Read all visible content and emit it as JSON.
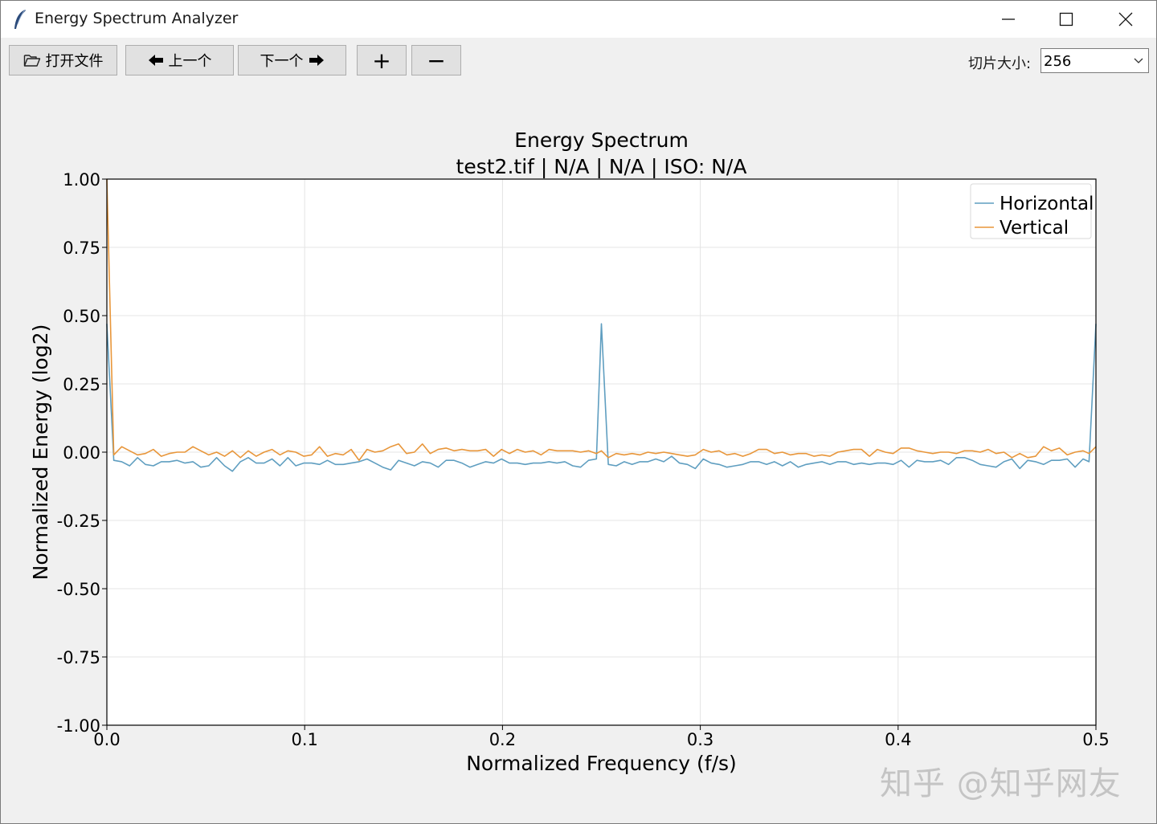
{
  "window": {
    "title": "Energy Spectrum Analyzer"
  },
  "toolbar": {
    "open_label": "打开文件",
    "prev_label": "上一个",
    "next_label": "下一个",
    "zoom_in_label": "+",
    "zoom_out_label": "−",
    "slice_size_label": "切片大小:",
    "slice_size_value": "256"
  },
  "icons": {
    "app": "feather-icon",
    "open": "folder-icon",
    "prev": "arrow-left-icon",
    "next": "arrow-right-icon",
    "minimize": "minimize-icon",
    "maximize": "maximize-icon",
    "close": "close-icon"
  },
  "watermark": "知乎 @知乎网友",
  "chart_data": {
    "type": "line",
    "title": "Energy Spectrum",
    "subtitle": "test2.tif | N/A | N/A | ISO: N/A",
    "xlabel": "Normalized Frequency (f/s)",
    "ylabel": "Normalized Energy (log2)",
    "xlim": [
      0,
      0.5
    ],
    "ylim": [
      -1,
      1
    ],
    "xticks": [
      0,
      0.1,
      0.2,
      0.3,
      0.4,
      0.5
    ],
    "xtick_labels": [
      "0.0",
      "0.1",
      "0.2",
      "0.3",
      "0.4",
      "0.5"
    ],
    "yticks": [
      1,
      0.75,
      0.5,
      0.25,
      0,
      -0.25,
      -0.5,
      -0.75,
      -1
    ],
    "ytick_labels": [
      "1.00",
      "0.75",
      "0.50",
      "0.25",
      "0.00",
      "-0.25",
      "-0.50",
      "-0.75",
      "-1.00"
    ],
    "grid": true,
    "legend": "top-right",
    "series": [
      {
        "name": "Horizontal",
        "color": "#5f9ec0",
        "points": [
          [
            0.0,
            0.47
          ],
          [
            0.0035,
            -0.03
          ],
          [
            0.0075,
            -0.035
          ],
          [
            0.0115,
            -0.05
          ],
          [
            0.0155,
            -0.02
          ],
          [
            0.0195,
            -0.045
          ],
          [
            0.0235,
            -0.05
          ],
          [
            0.0275,
            -0.035
          ],
          [
            0.0315,
            -0.035
          ],
          [
            0.0355,
            -0.03
          ],
          [
            0.0395,
            -0.04
          ],
          [
            0.0435,
            -0.035
          ],
          [
            0.0475,
            -0.055
          ],
          [
            0.0515,
            -0.05
          ],
          [
            0.0555,
            -0.02
          ],
          [
            0.0595,
            -0.05
          ],
          [
            0.0635,
            -0.07
          ],
          [
            0.0675,
            -0.035
          ],
          [
            0.0715,
            -0.02
          ],
          [
            0.0755,
            -0.04
          ],
          [
            0.0795,
            -0.04
          ],
          [
            0.0835,
            -0.025
          ],
          [
            0.0875,
            -0.05
          ],
          [
            0.0915,
            -0.02
          ],
          [
            0.0955,
            -0.05
          ],
          [
            0.0995,
            -0.04
          ],
          [
            0.1035,
            -0.04
          ],
          [
            0.1075,
            -0.045
          ],
          [
            0.1115,
            -0.03
          ],
          [
            0.1155,
            -0.045
          ],
          [
            0.1195,
            -0.045
          ],
          [
            0.1235,
            -0.04
          ],
          [
            0.1275,
            -0.035
          ],
          [
            0.1315,
            -0.025
          ],
          [
            0.1355,
            -0.04
          ],
          [
            0.1395,
            -0.055
          ],
          [
            0.1435,
            -0.065
          ],
          [
            0.1475,
            -0.03
          ],
          [
            0.1515,
            -0.04
          ],
          [
            0.1555,
            -0.05
          ],
          [
            0.1595,
            -0.035
          ],
          [
            0.1635,
            -0.04
          ],
          [
            0.1675,
            -0.055
          ],
          [
            0.1715,
            -0.03
          ],
          [
            0.1755,
            -0.03
          ],
          [
            0.1795,
            -0.04
          ],
          [
            0.1835,
            -0.055
          ],
          [
            0.1875,
            -0.045
          ],
          [
            0.1915,
            -0.035
          ],
          [
            0.1955,
            -0.04
          ],
          [
            0.1995,
            -0.025
          ],
          [
            0.2035,
            -0.04
          ],
          [
            0.2075,
            -0.04
          ],
          [
            0.2115,
            -0.045
          ],
          [
            0.2155,
            -0.04
          ],
          [
            0.2195,
            -0.04
          ],
          [
            0.2235,
            -0.035
          ],
          [
            0.2275,
            -0.04
          ],
          [
            0.2315,
            -0.035
          ],
          [
            0.2355,
            -0.05
          ],
          [
            0.2395,
            -0.055
          ],
          [
            0.2435,
            -0.03
          ],
          [
            0.2475,
            -0.025
          ],
          [
            0.25,
            0.47
          ],
          [
            0.2535,
            -0.045
          ],
          [
            0.2575,
            -0.05
          ],
          [
            0.2615,
            -0.035
          ],
          [
            0.2655,
            -0.045
          ],
          [
            0.2695,
            -0.035
          ],
          [
            0.2735,
            -0.035
          ],
          [
            0.2775,
            -0.025
          ],
          [
            0.2815,
            -0.035
          ],
          [
            0.2855,
            -0.015
          ],
          [
            0.2895,
            -0.04
          ],
          [
            0.2935,
            -0.045
          ],
          [
            0.2975,
            -0.06
          ],
          [
            0.3015,
            -0.025
          ],
          [
            0.3055,
            -0.04
          ],
          [
            0.3095,
            -0.045
          ],
          [
            0.3135,
            -0.055
          ],
          [
            0.3175,
            -0.05
          ],
          [
            0.3215,
            -0.045
          ],
          [
            0.3255,
            -0.035
          ],
          [
            0.3295,
            -0.035
          ],
          [
            0.3335,
            -0.045
          ],
          [
            0.3375,
            -0.035
          ],
          [
            0.3415,
            -0.05
          ],
          [
            0.3455,
            -0.035
          ],
          [
            0.3495,
            -0.055
          ],
          [
            0.3535,
            -0.045
          ],
          [
            0.3575,
            -0.04
          ],
          [
            0.3615,
            -0.035
          ],
          [
            0.3655,
            -0.045
          ],
          [
            0.3695,
            -0.035
          ],
          [
            0.3735,
            -0.035
          ],
          [
            0.3775,
            -0.045
          ],
          [
            0.3815,
            -0.04
          ],
          [
            0.3855,
            -0.045
          ],
          [
            0.3895,
            -0.04
          ],
          [
            0.3935,
            -0.04
          ],
          [
            0.3975,
            -0.045
          ],
          [
            0.4015,
            -0.03
          ],
          [
            0.4055,
            -0.055
          ],
          [
            0.4095,
            -0.03
          ],
          [
            0.4135,
            -0.035
          ],
          [
            0.4175,
            -0.035
          ],
          [
            0.4215,
            -0.03
          ],
          [
            0.4255,
            -0.045
          ],
          [
            0.4295,
            -0.02
          ],
          [
            0.4335,
            -0.02
          ],
          [
            0.4375,
            -0.03
          ],
          [
            0.4415,
            -0.045
          ],
          [
            0.4455,
            -0.05
          ],
          [
            0.4495,
            -0.055
          ],
          [
            0.4535,
            -0.035
          ],
          [
            0.4575,
            -0.025
          ],
          [
            0.4615,
            -0.06
          ],
          [
            0.4655,
            -0.03
          ],
          [
            0.4695,
            -0.035
          ],
          [
            0.4735,
            -0.045
          ],
          [
            0.4775,
            -0.03
          ],
          [
            0.4815,
            -0.03
          ],
          [
            0.4855,
            -0.025
          ],
          [
            0.4895,
            -0.055
          ],
          [
            0.4935,
            -0.025
          ],
          [
            0.4965,
            -0.035
          ],
          [
            0.5,
            0.47
          ]
        ]
      },
      {
        "name": "Vertical",
        "color": "#e8963a",
        "points": [
          [
            0.0,
            1.0
          ],
          [
            0.0035,
            -0.01
          ],
          [
            0.0075,
            0.02
          ],
          [
            0.0115,
            0.005
          ],
          [
            0.0155,
            -0.01
          ],
          [
            0.0195,
            -0.005
          ],
          [
            0.0235,
            0.01
          ],
          [
            0.0275,
            -0.015
          ],
          [
            0.0315,
            -0.005
          ],
          [
            0.0355,
            0.0
          ],
          [
            0.0395,
            0.0
          ],
          [
            0.0435,
            0.02
          ],
          [
            0.0475,
            0.005
          ],
          [
            0.0515,
            -0.01
          ],
          [
            0.0555,
            0.0
          ],
          [
            0.0595,
            -0.015
          ],
          [
            0.0635,
            0.005
          ],
          [
            0.0675,
            -0.02
          ],
          [
            0.0715,
            0.005
          ],
          [
            0.0755,
            -0.015
          ],
          [
            0.0795,
            0.0
          ],
          [
            0.0835,
            0.01
          ],
          [
            0.0875,
            -0.01
          ],
          [
            0.0915,
            0.005
          ],
          [
            0.0955,
            0.0
          ],
          [
            0.0995,
            -0.015
          ],
          [
            0.1035,
            -0.01
          ],
          [
            0.1075,
            0.02
          ],
          [
            0.1115,
            -0.015
          ],
          [
            0.1155,
            -0.005
          ],
          [
            0.1195,
            -0.01
          ],
          [
            0.1235,
            0.01
          ],
          [
            0.1275,
            -0.03
          ],
          [
            0.1315,
            0.01
          ],
          [
            0.1355,
            0.0
          ],
          [
            0.1395,
            0.005
          ],
          [
            0.1435,
            0.02
          ],
          [
            0.1475,
            0.03
          ],
          [
            0.1515,
            -0.005
          ],
          [
            0.1555,
            0.0
          ],
          [
            0.1595,
            0.03
          ],
          [
            0.1635,
            -0.005
          ],
          [
            0.1675,
            0.01
          ],
          [
            0.1715,
            0.015
          ],
          [
            0.1755,
            0.005
          ],
          [
            0.1795,
            0.01
          ],
          [
            0.1835,
            0.005
          ],
          [
            0.1875,
            0.005
          ],
          [
            0.1915,
            0.01
          ],
          [
            0.1955,
            -0.015
          ],
          [
            0.1995,
            0.01
          ],
          [
            0.2035,
            -0.005
          ],
          [
            0.2075,
            0.01
          ],
          [
            0.2115,
            0.0
          ],
          [
            0.2155,
            0.005
          ],
          [
            0.2195,
            -0.01
          ],
          [
            0.2235,
            0.01
          ],
          [
            0.2275,
            0.005
          ],
          [
            0.2315,
            0.005
          ],
          [
            0.2355,
            0.005
          ],
          [
            0.2395,
            0.0
          ],
          [
            0.2435,
            0.005
          ],
          [
            0.2475,
            -0.005
          ],
          [
            0.25,
            0.005
          ],
          [
            0.2535,
            -0.02
          ],
          [
            0.2575,
            -0.005
          ],
          [
            0.2615,
            -0.01
          ],
          [
            0.2655,
            -0.005
          ],
          [
            0.2695,
            -0.01
          ],
          [
            0.2735,
            0.0
          ],
          [
            0.2775,
            -0.005
          ],
          [
            0.2815,
            0.0
          ],
          [
            0.2855,
            -0.005
          ],
          [
            0.2895,
            -0.01
          ],
          [
            0.2935,
            -0.015
          ],
          [
            0.2975,
            -0.01
          ],
          [
            0.3015,
            0.01
          ],
          [
            0.3055,
            0.0
          ],
          [
            0.3095,
            0.005
          ],
          [
            0.3135,
            -0.01
          ],
          [
            0.3175,
            -0.005
          ],
          [
            0.3215,
            -0.015
          ],
          [
            0.3255,
            -0.005
          ],
          [
            0.3295,
            0.01
          ],
          [
            0.3335,
            0.01
          ],
          [
            0.3375,
            -0.005
          ],
          [
            0.3415,
            0.0
          ],
          [
            0.3455,
            -0.01
          ],
          [
            0.3495,
            -0.005
          ],
          [
            0.3535,
            -0.005
          ],
          [
            0.3575,
            -0.015
          ],
          [
            0.3615,
            -0.01
          ],
          [
            0.3655,
            -0.015
          ],
          [
            0.3695,
            0.0
          ],
          [
            0.3735,
            0.005
          ],
          [
            0.3775,
            0.01
          ],
          [
            0.3815,
            0.01
          ],
          [
            0.3855,
            -0.015
          ],
          [
            0.3895,
            0.01
          ],
          [
            0.3935,
            0.0
          ],
          [
            0.3975,
            -0.005
          ],
          [
            0.4015,
            0.015
          ],
          [
            0.4055,
            0.015
          ],
          [
            0.4095,
            0.005
          ],
          [
            0.4135,
            0.0
          ],
          [
            0.4175,
            -0.005
          ],
          [
            0.4215,
            0.0
          ],
          [
            0.4255,
            0.0
          ],
          [
            0.4295,
            -0.005
          ],
          [
            0.4335,
            0.005
          ],
          [
            0.4375,
            0.005
          ],
          [
            0.4415,
            0.0
          ],
          [
            0.4455,
            0.01
          ],
          [
            0.4495,
            -0.005
          ],
          [
            0.4535,
            0.0
          ],
          [
            0.4575,
            -0.02
          ],
          [
            0.4615,
            -0.005
          ],
          [
            0.4655,
            -0.02
          ],
          [
            0.4695,
            -0.015
          ],
          [
            0.4735,
            0.02
          ],
          [
            0.4775,
            0.005
          ],
          [
            0.4815,
            0.015
          ],
          [
            0.4855,
            -0.01
          ],
          [
            0.4895,
            0.0
          ],
          [
            0.4935,
            0.005
          ],
          [
            0.4965,
            -0.005
          ],
          [
            0.5,
            0.02
          ]
        ]
      }
    ]
  }
}
